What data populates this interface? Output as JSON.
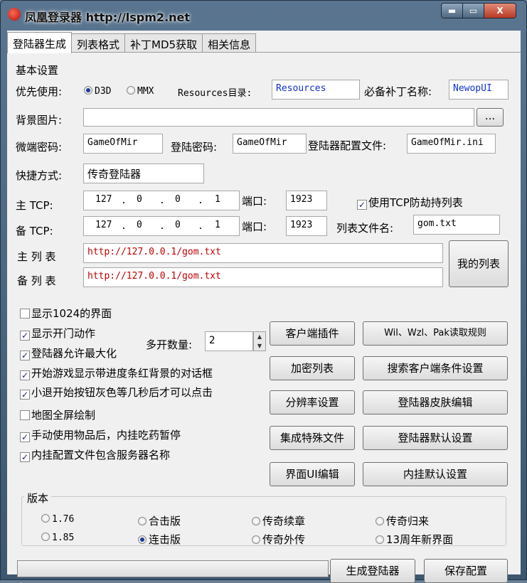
{
  "window": {
    "title": "凤凰登录器 http://lspm2.net",
    "min_symbol": "▬",
    "max_symbol": "▭",
    "close_symbol": "X"
  },
  "tabs": [
    "登陆器生成",
    "列表格式",
    "补丁MD5获取",
    "相关信息"
  ],
  "basic": {
    "section_title": "基本设置",
    "priority_label": "优先使用:",
    "priority_options": [
      "D3D",
      "MMX"
    ],
    "priority_selected": "D3D",
    "resources_label": "Resources目录:",
    "resources_value": "Resources",
    "patch_label": "必备补丁名称:",
    "patch_value": "NewopUI",
    "bg_label": "背景图片:",
    "bg_value": "",
    "browse_label": "...",
    "micro_pwd_label": "微端密码:",
    "micro_pwd_value": "GameOfMir",
    "login_pwd_label": "登陆密码:",
    "login_pwd_value": "GameOfMir",
    "config_file_label": "登陆器配置文件:",
    "config_file_value": "GameOfMir.ini",
    "shortcut_label": "快捷方式:",
    "shortcut_value": "传奇登陆器",
    "main_tcp_label": "主 TCP:",
    "main_tcp_ip": [
      "127",
      "0",
      "0",
      "1"
    ],
    "port_label": "端口:",
    "main_port": "1923",
    "anti_hijack_label": "使用TCP防劫持列表",
    "backup_tcp_label": "备 TCP:",
    "backup_tcp_ip": [
      "127",
      "0",
      "0",
      "1"
    ],
    "backup_port": "1923",
    "list_file_label": "列表文件名:",
    "list_file_value": "gom.txt",
    "main_list_label": "主 列 表",
    "main_list_value": "http://127.0.0.1/gom.txt",
    "backup_list_label": "备 列 表",
    "backup_list_value": "http://127.0.0.1/gom.txt",
    "my_list_button": "我的列表"
  },
  "options": {
    "checks": [
      {
        "label": "显示1024的界面",
        "checked": false
      },
      {
        "label": "显示开门动作",
        "checked": true
      },
      {
        "label": "登陆器允许最大化",
        "checked": true
      },
      {
        "label": "开始游戏显示带进度条红背景的对话框",
        "checked": true
      },
      {
        "label": "小退开始按钮灰色等几秒后才可以点击",
        "checked": true
      },
      {
        "label": "地图全屏绘制",
        "checked": false
      },
      {
        "label": "手动使用物品后，内挂吃药暂停",
        "checked": true
      },
      {
        "label": "内挂配置文件包含服务器名称",
        "checked": true
      }
    ],
    "multi_open_label": "多开数量:",
    "multi_open_value": "2"
  },
  "buttons": {
    "client_plugin": "客户端插件",
    "read_rules": "Wil、Wzl、Pak读取规则",
    "encrypt_list": "加密列表",
    "search_client": "搜索客户端条件设置",
    "resolution": "分辨率设置",
    "skin_edit": "登陆器皮肤编辑",
    "integrate_files": "集成特殊文件",
    "default_settings": "登陆器默认设置",
    "ui_edit": "界面UI编辑",
    "plugin_default": "内挂默认设置",
    "generate": "生成登陆器",
    "save_config": "保存配置"
  },
  "version": {
    "group_label": "版本",
    "options": [
      {
        "label": "1.76",
        "selected": false
      },
      {
        "label": "合击版",
        "selected": false
      },
      {
        "label": "传奇续章",
        "selected": false
      },
      {
        "label": "传奇归来",
        "selected": false
      },
      {
        "label": "1.85",
        "selected": false
      },
      {
        "label": "连击版",
        "selected": true
      },
      {
        "label": "传奇外传",
        "selected": false
      },
      {
        "label": "13周年新界面",
        "selected": false
      }
    ]
  },
  "progress_fraction": 0.0
}
